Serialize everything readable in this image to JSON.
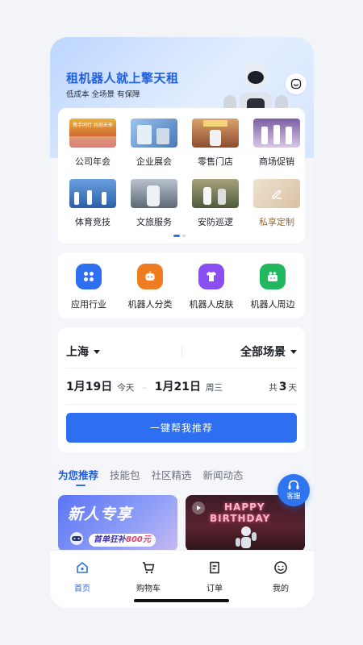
{
  "hero": {
    "title": "租机器人就上擎天租",
    "subtitle": "低成本 全场景 有保障"
  },
  "categories": [
    {
      "label": "公司年会",
      "thumb_text": "携手同行 共创未来",
      "thumb_color": "#c0392b"
    },
    {
      "label": "企业展会",
      "thumb_text": "",
      "thumb_color": "#5a8ac8"
    },
    {
      "label": "零售门店",
      "thumb_text": "",
      "thumb_color": "#a55a3c"
    },
    {
      "label": "商场促销",
      "thumb_text": "",
      "thumb_color": "#6a4d8a"
    },
    {
      "label": "体育竞技",
      "thumb_text": "",
      "thumb_color": "#2f6ab5"
    },
    {
      "label": "文旅服务",
      "thumb_text": "",
      "thumb_color": "#7f8a96"
    },
    {
      "label": "安防巡逻",
      "thumb_text": "",
      "thumb_color": "#6f6a4a"
    },
    {
      "label": "私享定制",
      "thumb_text": "",
      "thumb_color": "#e2d0b8"
    }
  ],
  "quick_links": [
    {
      "label": "应用行业",
      "icon": "grid-icon",
      "color": "#2d6ff0"
    },
    {
      "label": "机器人分类",
      "icon": "robot-icon",
      "color": "#f07c22"
    },
    {
      "label": "机器人皮肤",
      "icon": "shirt-icon",
      "color": "#8a4ff0"
    },
    {
      "label": "机器人周边",
      "icon": "gift-icon",
      "color": "#22b860"
    }
  ],
  "booking": {
    "city": "上海",
    "scene": "全部场景",
    "start_date": "1月19日",
    "start_day": "今天",
    "end_date": "1月21日",
    "end_day": "周三",
    "total_prefix": "共",
    "total_days": "3",
    "total_suffix": "天",
    "recommend_button": "一键帮我推荐"
  },
  "feed_tabs": [
    "为您推荐",
    "技能包",
    "社区精选",
    "新闻动态"
  ],
  "service_button": "客服",
  "promos": {
    "left_title": "新人专享",
    "left_sub_prefix": "首单狂补",
    "left_sub_amount": "800元",
    "right_line1": "HAPPY",
    "right_line2": "BIRTHDAY"
  },
  "bottom_nav": [
    {
      "label": "首页",
      "icon": "home-icon"
    },
    {
      "label": "购物车",
      "icon": "cart-icon"
    },
    {
      "label": "订单",
      "icon": "order-icon"
    },
    {
      "label": "我的",
      "icon": "profile-icon"
    }
  ],
  "colors": {
    "accent": "#2d6ff0",
    "brand_title": "#1f5fe0",
    "custom_label": "#9a6a2f"
  }
}
